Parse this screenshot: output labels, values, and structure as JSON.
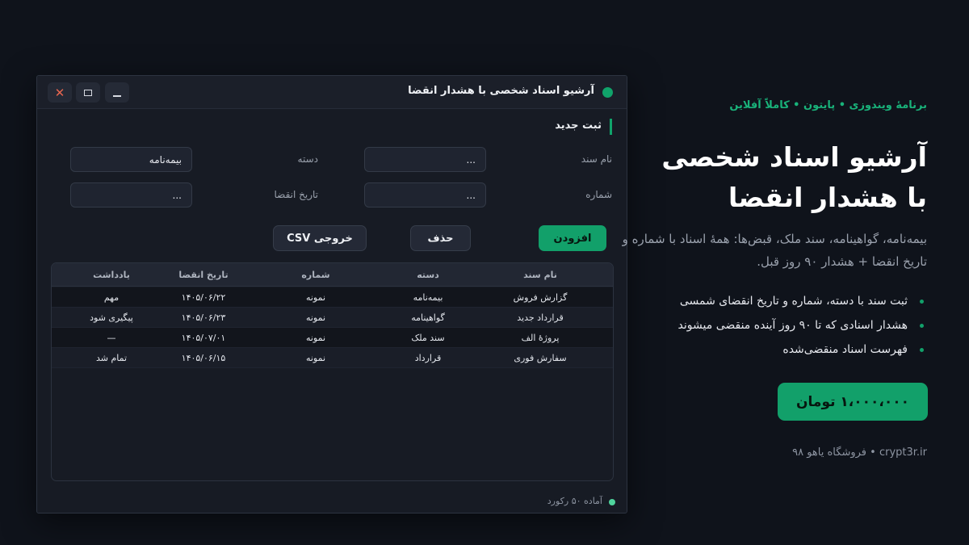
{
  "window": {
    "title": "آرشیو اسناد شخصی با هشدار انقضا",
    "close_glyph": "✕"
  },
  "form": {
    "section_title": "ثبت جدید",
    "fields": {
      "doc_name_label": "نام سند",
      "doc_name_value": "...",
      "category_label": "دسته",
      "category_value": "بیمه‌نامه",
      "number_label": "شماره",
      "number_value": "...",
      "expiry_label": "تاریخ انقضا",
      "expiry_value": "..."
    },
    "buttons": {
      "add": "افزودن",
      "delete": "حذف",
      "csv": "خروجی CSV"
    }
  },
  "table": {
    "headers": [
      "نام سند",
      "دسته",
      "شماره",
      "تاریخ انقضا",
      "یادداشت"
    ],
    "rows": [
      [
        "گزارش فروش",
        "بیمه‌نامه",
        "نمونه",
        "۱۴۰۵/۰۶/۲۲",
        "مهم"
      ],
      [
        "قرارداد جدید",
        "گواهینامه",
        "نمونه",
        "۱۴۰۵/۰۶/۲۳",
        "پیگیری شود"
      ],
      [
        "پروژهٔ الف",
        "سند ملک",
        "نمونه",
        "۱۴۰۵/۰۷/۰۱",
        "—"
      ],
      [
        "سفارش فوری",
        "قرارداد",
        "نمونه",
        "۱۴۰۵/۰۶/۱۵",
        "تمام شد"
      ]
    ]
  },
  "status": {
    "text": "آماده ۵۰ رکورد"
  },
  "promo": {
    "tagline": "برنامهٔ ویندوزی • پایتون • کاملاً آفلاین",
    "headline_line1": "آرشیو اسناد شخصی",
    "headline_line2": "با هشدار انقضا",
    "description": "بیمه‌نامه، گواهینامه، سند ملک، قبض‌ها: همهٔ اسناد با شماره و تاریخ انقضا + هشدار ۹۰ روز قبل.",
    "features": [
      "ثبت سند با دسته، شماره و تاریخ انقضای شمسی",
      "هشدار اسنادی که تا ۹۰ روز آینده منقضی میشوند",
      "فهرست اسناد منقضی‌شده"
    ],
    "price": "۱،۰۰۰،۰۰۰ تومان",
    "shop": "فروشگاه یاهو ۹۸ • crypt3r.ir"
  },
  "colors": {
    "accent": "#12a06a",
    "background": "#0f131b",
    "window": "#171b24"
  }
}
